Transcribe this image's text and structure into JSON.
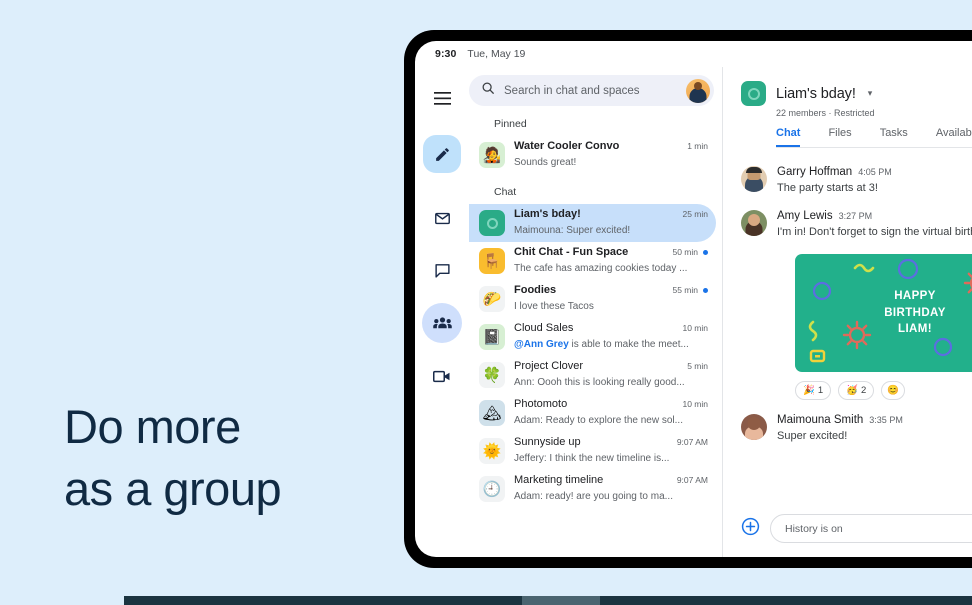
{
  "hero": {
    "headline": "Do more\nas a group"
  },
  "device": {
    "status_time": "9:30",
    "status_date": "Tue, May 19"
  },
  "rail": {
    "items": [
      {
        "name": "menu",
        "label": "Menu"
      },
      {
        "name": "compose",
        "label": "Compose"
      },
      {
        "name": "mail",
        "label": "Mail"
      },
      {
        "name": "chat",
        "label": "Chat"
      },
      {
        "name": "spaces",
        "label": "Spaces"
      },
      {
        "name": "meet",
        "label": "Meet"
      }
    ]
  },
  "search": {
    "placeholder": "Search in chat and spaces"
  },
  "list": {
    "pinned_label": "Pinned",
    "chat_label": "Chat",
    "pinned": [
      {
        "title": "Water Cooler Convo",
        "preview": "Sounds great!",
        "time": "1 min",
        "unread": false,
        "emoji": "🧑‍🎤",
        "ava_bg": "#d7efd3"
      }
    ],
    "chats": [
      {
        "title": "Liam's bday!",
        "preview": "Maimouna: Super excited!",
        "time": "25 min",
        "unread": false,
        "selected": true,
        "emoji": "",
        "ava_bg": "#2aab87"
      },
      {
        "title": "Chit Chat - Fun Space",
        "preview": "The cafe has amazing cookies today ...",
        "time": "50 min",
        "unread": true,
        "emoji": "🪑",
        "ava_bg": "#f9bc2e"
      },
      {
        "title": "Foodies",
        "preview": "I love these Tacos",
        "time": "55 min",
        "unread": true,
        "emoji": "🌮",
        "ava_bg": "#f1f3f4"
      },
      {
        "title": "Cloud Sales",
        "preview_mention": "@Ann Grey",
        "preview": " is able to make the meet...",
        "time": "10 min",
        "unread": false,
        "emoji": "📓",
        "ava_bg": "#d7efd3"
      },
      {
        "title": "Project Clover",
        "preview": "Ann: Oooh this is looking really good...",
        "time": "5 min",
        "unread": false,
        "emoji": "🍀",
        "ava_bg": "#f1f3f4"
      },
      {
        "title": "Photomoto",
        "preview": "Adam: Ready to explore the new sol...",
        "time": "10 min",
        "unread": false,
        "emoji": "🏔",
        "ava_bg": "#cfe0ea"
      },
      {
        "title": "Sunnyside up",
        "preview": "Jeffery: I think the new timeline is...",
        "time": "9:07 AM",
        "unread": false,
        "emoji": "🌞",
        "ava_bg": "#f1f3f4"
      },
      {
        "title": "Marketing timeline",
        "preview": "Adam: ready! are you going to ma...",
        "time": "9:07 AM",
        "unread": false,
        "emoji": "🕘",
        "ava_bg": "#f1f3f4"
      }
    ]
  },
  "conversation": {
    "title": "Liam's bday!",
    "subtitle": "22 members · Restricted",
    "tabs": [
      {
        "label": "Chat",
        "active": true
      },
      {
        "label": "Files",
        "active": false
      },
      {
        "label": "Tasks",
        "active": false
      },
      {
        "label": "Availabi",
        "active": false
      }
    ],
    "messages": [
      {
        "author": "Garry Hoffman",
        "time": "4:05 PM",
        "text": "The party starts at 3!",
        "ava_bg": "#e2cdb2"
      },
      {
        "author": "Amy Lewis",
        "time": "3:27 PM",
        "text": "I'm in! Don't forget to sign the virtual birth",
        "ava_bg": "#7d8f63"
      }
    ],
    "card": {
      "text": "HAPPY\nBIRTHDAY\nLIAM!",
      "bg": "#22b08b"
    },
    "reactions": [
      {
        "emoji": "🎉",
        "count": "1"
      },
      {
        "emoji": "🥳",
        "count": "2"
      },
      {
        "emoji": "😊",
        "count": ""
      }
    ],
    "last_message": {
      "author": "Maimouna Smith",
      "time": "3:35 PM",
      "text": "Super excited!",
      "ava_bg": "#8a5a48"
    },
    "composer_placeholder": "History is on"
  },
  "colors": {
    "page_bg": "#ddeefb",
    "accent_blue": "#1a73e8",
    "selected_row": "#c7dffa",
    "green": "#22b08b",
    "headline": "#102a43"
  }
}
